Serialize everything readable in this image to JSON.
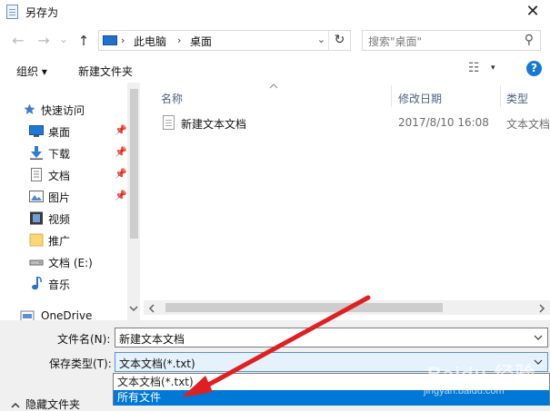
{
  "window": {
    "title": "另存为",
    "close_glyph": "✕"
  },
  "nav": {
    "back_glyph": "←",
    "forward_glyph": "→",
    "dropdown_glyph": "⌄",
    "up_glyph": "↑"
  },
  "address": {
    "sep1": "›",
    "segment1": "此电脑",
    "sep2": "›",
    "segment2": "桌面",
    "dropdown_glyph": "⌄",
    "refresh_glyph": "↻"
  },
  "search": {
    "placeholder": "搜索\"桌面\"",
    "icon": "search-icon",
    "icon_glyph": "⚲"
  },
  "toolbar": {
    "organize": "组织 ▾",
    "new_folder": "新建文件夹",
    "view_glyph": "☷",
    "view_dropdown": "▾",
    "help": "?"
  },
  "sidebar": {
    "items": [
      {
        "label": "快速访问",
        "icon": "star-icon",
        "pinned": false
      },
      {
        "label": "桌面",
        "icon": "desktop-icon",
        "pinned": true
      },
      {
        "label": "下载",
        "icon": "download-icon",
        "pinned": true
      },
      {
        "label": "文档",
        "icon": "document-icon",
        "pinned": true
      },
      {
        "label": "图片",
        "icon": "picture-icon",
        "pinned": true
      },
      {
        "label": "视频",
        "icon": "video-icon",
        "pinned": false
      },
      {
        "label": "推广",
        "icon": "folder-icon",
        "pinned": false
      },
      {
        "label": "文档 (E:)",
        "icon": "drive-icon",
        "pinned": false
      },
      {
        "label": "音乐",
        "icon": "music-icon",
        "pinned": false
      },
      {
        "label": "OneDrive",
        "icon": "cloud-icon",
        "pinned": false
      }
    ],
    "pin_glyph": "📌"
  },
  "columns": {
    "name": "名称",
    "modified": "修改日期",
    "type": "类型"
  },
  "files": [
    {
      "name": "新建文本文档",
      "modified": "2017/8/10 16:08",
      "type": "文本文档"
    }
  ],
  "form": {
    "filename_label": "文件名(N):",
    "filename_value": "新建文本文档",
    "filetype_label": "保存类型(T):",
    "filetype_value": "文本文档(*.txt)",
    "options": [
      "文本文档(*.txt)",
      "所有文件"
    ],
    "selected_option": "所有文件",
    "hide_folders": "隐藏文件夹",
    "dropdown_glyph": "⌄"
  },
  "watermark": {
    "line1": "Baidu 经验",
    "line2": "jingyan.baidu.com"
  },
  "colors": {
    "accent": "#0078d7",
    "annotation": "#e02020",
    "help": "#1779d4"
  }
}
